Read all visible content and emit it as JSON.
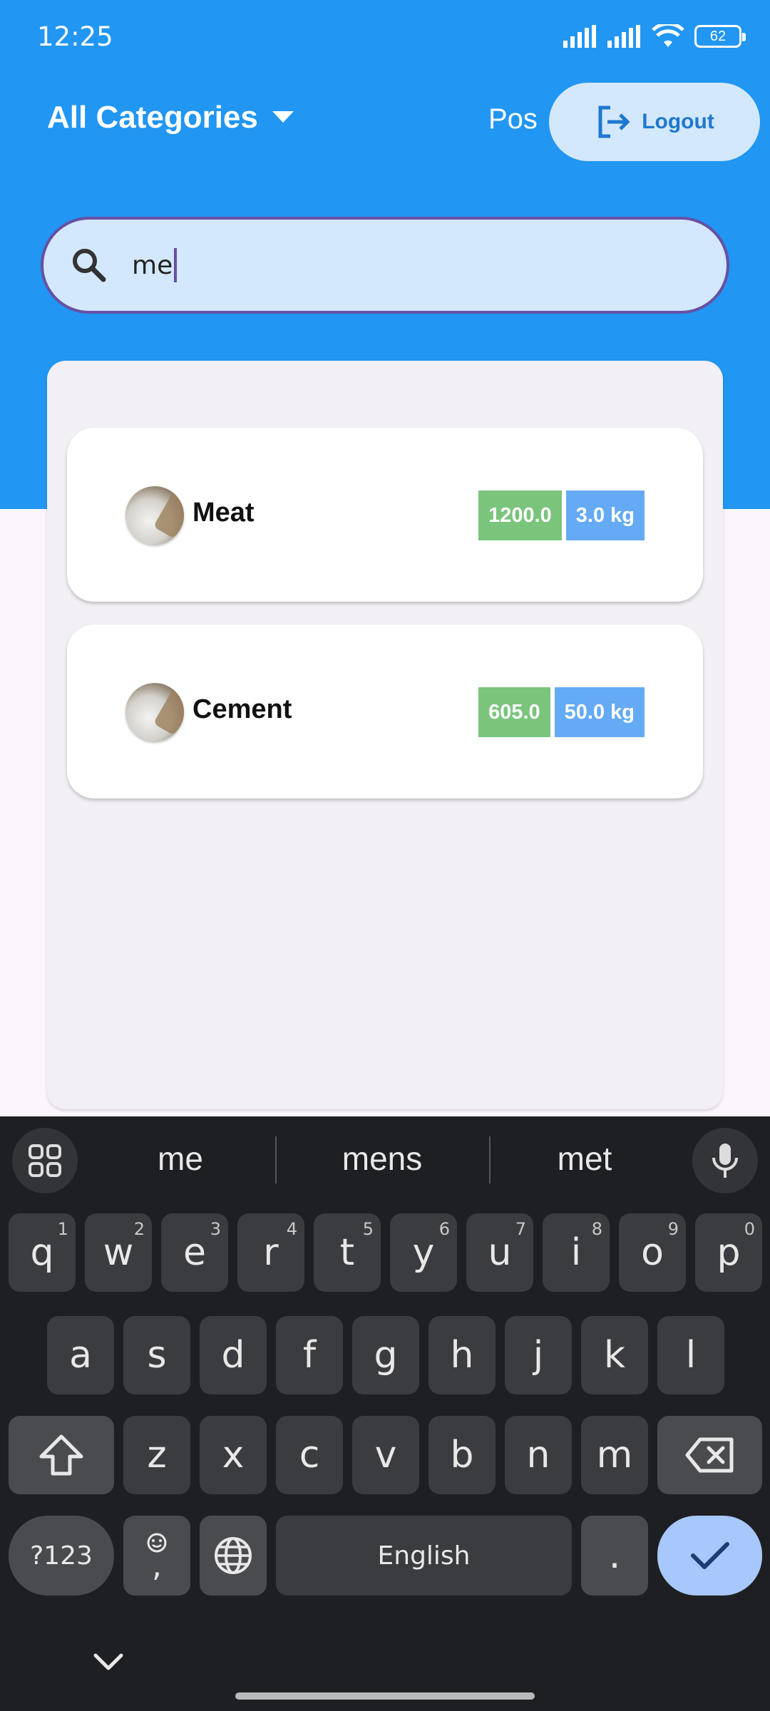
{
  "status_bar": {
    "time": "12:25",
    "battery": "62"
  },
  "header": {
    "category_dropdown": "All Categories",
    "pos_label": "Pos",
    "logout_label": "Logout"
  },
  "search": {
    "value": "me"
  },
  "products": [
    {
      "name": "Meat",
      "price": "1200.0",
      "quantity": "3.0 kg"
    },
    {
      "name": "Cement",
      "price": "605.0",
      "quantity": "50.0 kg"
    }
  ],
  "keyboard": {
    "suggestions": [
      "me",
      "mens",
      "met"
    ],
    "row1": [
      {
        "key": "q",
        "hint": "1"
      },
      {
        "key": "w",
        "hint": "2"
      },
      {
        "key": "e",
        "hint": "3"
      },
      {
        "key": "r",
        "hint": "4"
      },
      {
        "key": "t",
        "hint": "5"
      },
      {
        "key": "y",
        "hint": "6"
      },
      {
        "key": "u",
        "hint": "7"
      },
      {
        "key": "i",
        "hint": "8"
      },
      {
        "key": "o",
        "hint": "9"
      },
      {
        "key": "p",
        "hint": "0"
      }
    ],
    "row2": [
      "a",
      "s",
      "d",
      "f",
      "g",
      "h",
      "j",
      "k",
      "l"
    ],
    "row3": [
      "z",
      "x",
      "c",
      "v",
      "b",
      "n",
      "m"
    ],
    "symbols_label": "?123",
    "emoji_comma": ",",
    "space_label": "English",
    "period": "."
  },
  "colors": {
    "app_bar": "#2196f3",
    "search_bg": "#d3e8fc",
    "search_border": "#6750a4",
    "price_badge": "#7ac47c",
    "qty_badge": "#64aaf4",
    "keyboard_bg": "#1e1f22",
    "enter_key": "#a8c7fa"
  }
}
